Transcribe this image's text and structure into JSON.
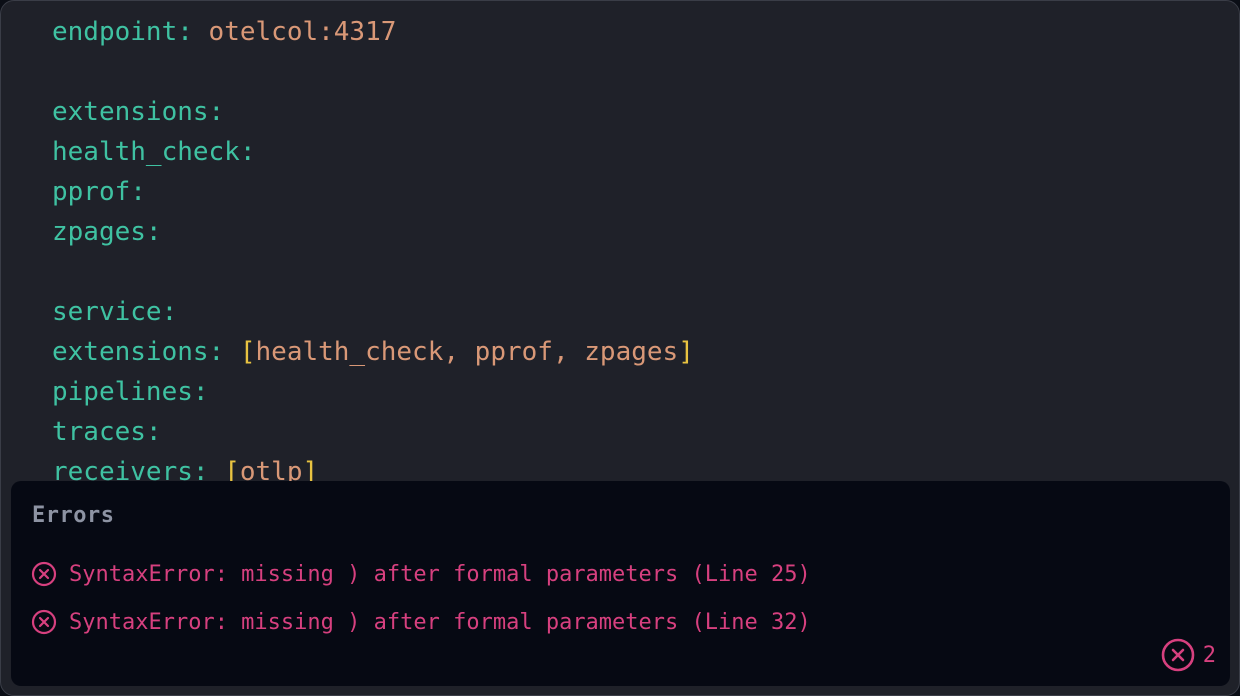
{
  "code_lines": [
    {
      "key": "",
      "sep": "",
      "value": "",
      "tail": "..."
    },
    {
      "key": "endpoint",
      "sep": ": ",
      "value": "otelcol:4317"
    },
    {
      "blank": true
    },
    {
      "key": "extensions",
      "sep": ":"
    },
    {
      "key": "health_check",
      "sep": ":"
    },
    {
      "key": "pprof",
      "sep": ":"
    },
    {
      "key": "zpages",
      "sep": ":"
    },
    {
      "blank": true
    },
    {
      "key": "service",
      "sep": ":"
    },
    {
      "key": "extensions",
      "sep": ": ",
      "list": [
        "health_check",
        "pprof",
        "zpages"
      ]
    },
    {
      "key": "pipelines",
      "sep": ":"
    },
    {
      "key": "traces",
      "sep": ":"
    },
    {
      "key": "receivers",
      "sep": ": ",
      "list": [
        "otlp"
      ]
    }
  ],
  "errors_panel": {
    "title": "Errors",
    "items": [
      {
        "message": "SyntaxError: missing ) after formal parameters (Line 25)",
        "icon": "error-circle-x-icon"
      },
      {
        "message": "SyntaxError: missing ) after formal parameters (Line 32)",
        "icon": "error-circle-x-icon"
      }
    ],
    "count": "2"
  },
  "colors": {
    "background": "#1f2129",
    "key": "#3fc2a2",
    "value": "#d99877",
    "bracket": "#e8c341",
    "error": "#d7407f",
    "panel": "#060913"
  }
}
